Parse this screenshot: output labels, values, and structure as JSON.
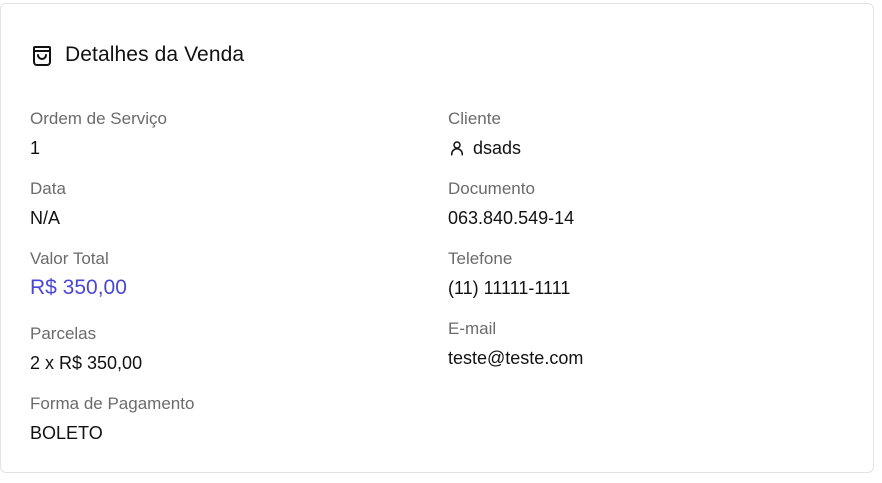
{
  "card": {
    "title": "Detalhes da Venda",
    "icon": "shopping-bag-icon"
  },
  "left": {
    "ordem_label": "Ordem de Serviço",
    "ordem_value": "1",
    "data_label": "Data",
    "data_value": "N/A",
    "valor_label": "Valor Total",
    "valor_value": "R$ 350,00",
    "parcelas_label": "Parcelas",
    "parcelas_value": "2 x R$ 350,00",
    "forma_label": "Forma de Pagamento",
    "forma_value": "BOLETO"
  },
  "right": {
    "cliente_label": "Cliente",
    "cliente_value": "dsads",
    "cliente_icon": "user-icon",
    "documento_label": "Documento",
    "documento_value": "063.840.549-14",
    "telefone_label": "Telefone",
    "telefone_value": "(11) 11111-1111",
    "email_label": "E-mail",
    "email_value": "teste@teste.com"
  },
  "colors": {
    "accent": "#4a47d6",
    "label": "#6b6b6b",
    "text": "#111111",
    "border": "#e3e3e3"
  }
}
